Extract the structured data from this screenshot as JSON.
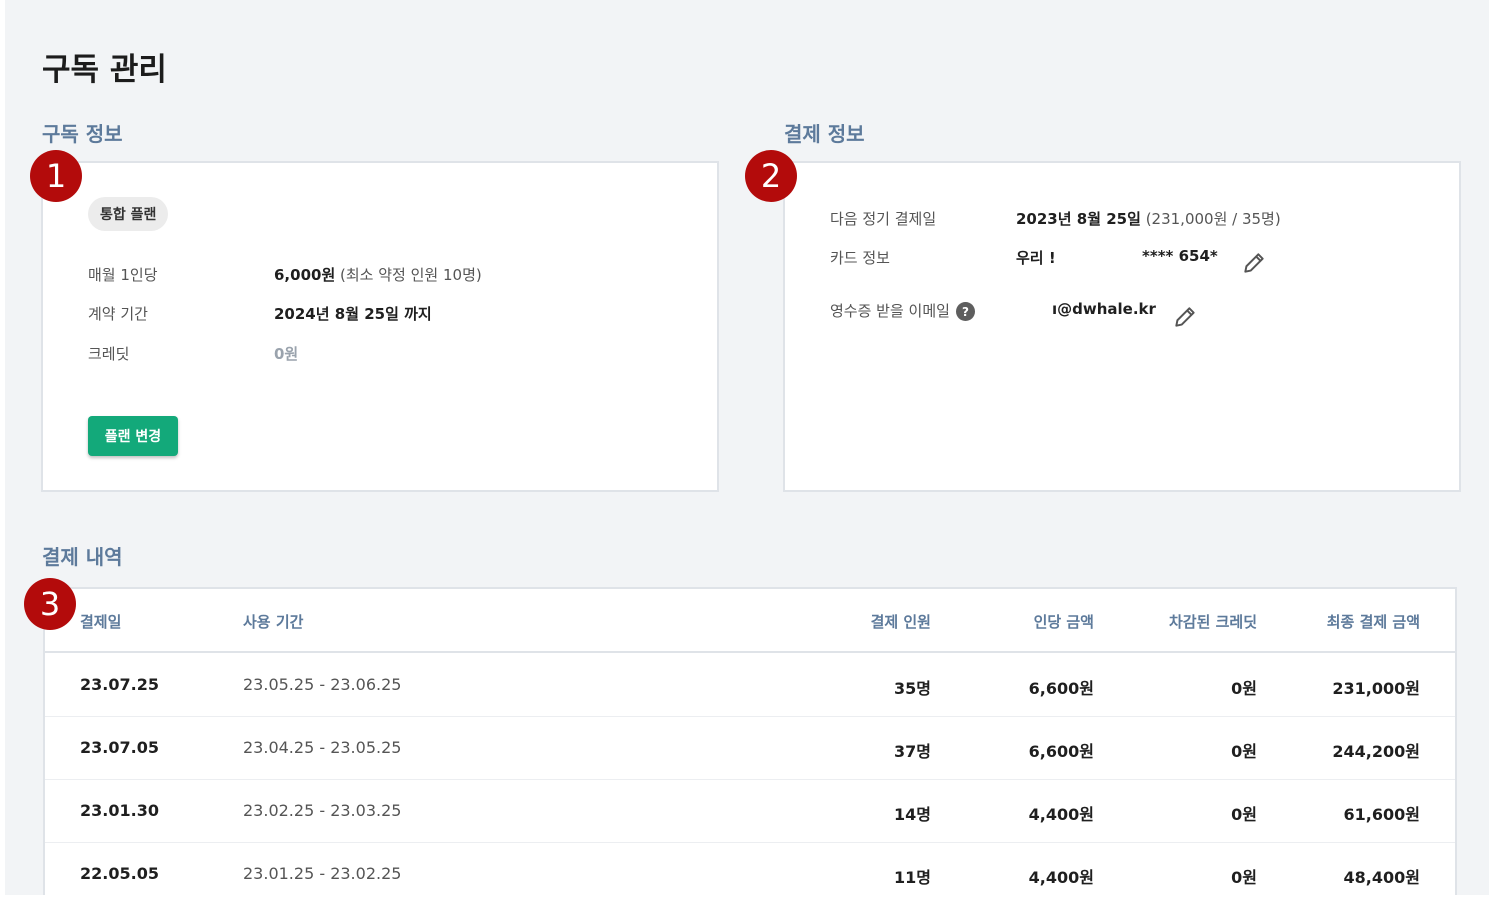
{
  "page_title": "구독 관리",
  "subscription": {
    "section_title": "구독 정보",
    "marker": "1",
    "plan_badge": "통합 플랜",
    "rows": [
      {
        "label": "매월 1인당",
        "value": "6,000원",
        "note": "(최소 약정 인원 10명)"
      },
      {
        "label": "계약 기간",
        "value": "2024년 8월 25일 까지",
        "note": ""
      },
      {
        "label": "크레딧",
        "value": "0원",
        "note": ""
      }
    ],
    "change_plan_button": "플랜 변경"
  },
  "payment": {
    "section_title": "결제 정보",
    "marker": "2",
    "next_billing_label": "다음 정기 결제일",
    "next_billing_date": "2023년 8월 25일",
    "next_billing_note": "(231,000원 / 35명)",
    "card_label": "카드 정보",
    "card_bank": "우리 !",
    "card_number": "**** 654*",
    "receipt_email_label": "영수증 받을 이메일",
    "receipt_email_value": "ı@dwhale.kr",
    "help_icon": "question-circle-icon",
    "edit_icon": "pencil-icon"
  },
  "history": {
    "section_title": "결제 내역",
    "marker": "3",
    "columns": [
      "결제일",
      "사용 기간",
      "결제 인원",
      "인당 금액",
      "차감된 크레딧",
      "최종 결제 금액"
    ],
    "rows": [
      {
        "date": "23.07.25",
        "period": "23.05.25 - 23.06.25",
        "members": "35명",
        "per_person": "6,600원",
        "credit": "0원",
        "total": "231,000원"
      },
      {
        "date": "23.07.05",
        "period": "23.04.25 - 23.05.25",
        "members": "37명",
        "per_person": "6,600원",
        "credit": "0원",
        "total": "244,200원"
      },
      {
        "date": "23.01.30",
        "period": "23.02.25 - 23.03.25",
        "members": "14명",
        "per_person": "4,400원",
        "credit": "0원",
        "total": "61,600원"
      },
      {
        "date": "22.05.05",
        "period": "23.01.25 - 23.02.25",
        "members": "11명",
        "per_person": "4,400원",
        "credit": "0원",
        "total": "48,400원"
      }
    ]
  },
  "colors": {
    "accent_green": "#13a97a",
    "section_blue": "#5d7a9b",
    "marker_red": "#b30b0b"
  }
}
